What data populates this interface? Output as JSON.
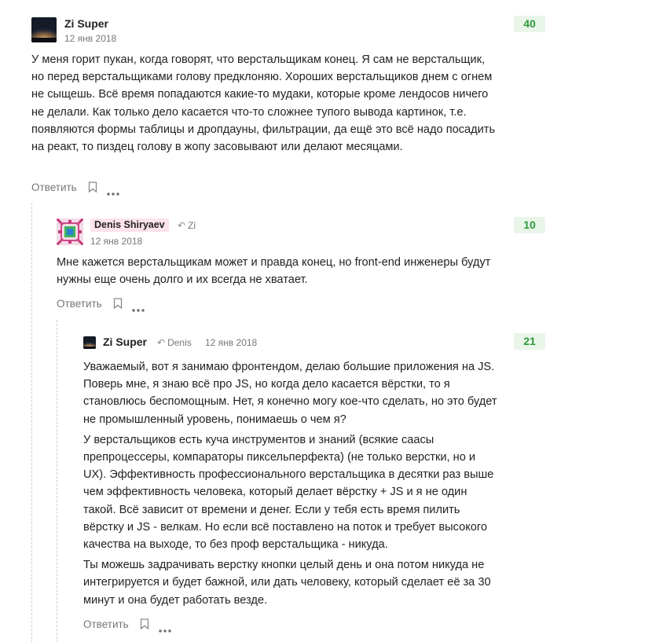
{
  "comments": [
    {
      "author": "Zi Super",
      "date": "12 янв 2018",
      "score": "40",
      "paragraphs": [
        "У меня горит пукан, когда говорят, что верстальщикам конец. Я сам не верстальщик, но перед верстальщиками голову предклоняю. Хороших верстальщиков днем с огнем не сыщешь. Всё время попадаются какие-то мудаки, которые кроме лендосов ничего не делали. Как только дело касается что-то сложнее тупого вывода картинок, т.е. появляются формы таблицы и дропдауны, фильтрации, да ещё это всё надо посадить на реакт, то пиздец голову в жопу засовывают или делают месяцами."
      ],
      "reply_label": "Ответить"
    },
    {
      "author": "Denis Shiryaev",
      "reply_to": "Zi",
      "date": "12 янв 2018",
      "score": "10",
      "paragraphs": [
        "Мне кажется верстальщикам может и правда конец, но front-end инженеры будут нужны еще очень долго и их всегда не хватает."
      ],
      "reply_label": "Ответить"
    },
    {
      "author": "Zi Super",
      "reply_to": "Denis",
      "date": "12 янв 2018",
      "score": "21",
      "paragraphs": [
        "Уважаемый, вот я занимаю фронтендом, делаю большие приложения на JS. Поверь мне, я знаю всё про JS, но когда дело касается вёрстки, то я становлюсь беспомощным. Нет, я конечно могу кое-что сделать, но это будет не промышленный уровень, понимаешь о чем я?",
        "У верстальщиков есть куча инструментов и знаний (всякие саасы препроцессеры, компараторы пиксельперфекта) (не только верстки, но и UX). Эффективность профессионального верстальщика в десятки раз выше чем эффективность человека, который делает вёрстку + JS и я не один такой. Всё зависит от времени и денег. Если у тебя есть время пилить вёрстку и JS - велкам. Но если всё поставлено на поток и требует высокого качества на выходе, то без проф верстальщика - никуда.",
        "Ты можешь задрачивать верстку кнопки целый день и она потом никуда не интегрируется и будет бажной, или дать человеку, который сделает её за 30 минут и она будет работать везде."
      ],
      "reply_label": "Ответить"
    }
  ],
  "icons": {
    "reply_arrow": "reply-arrow-icon",
    "bookmark": "bookmark-icon",
    "more": "more-dots-icon"
  },
  "colors": {
    "score_text": "#2c9a39",
    "score_bg": "#eaf5ea",
    "author_highlight_bg": "#fde3ea",
    "muted_text": "#767676"
  }
}
